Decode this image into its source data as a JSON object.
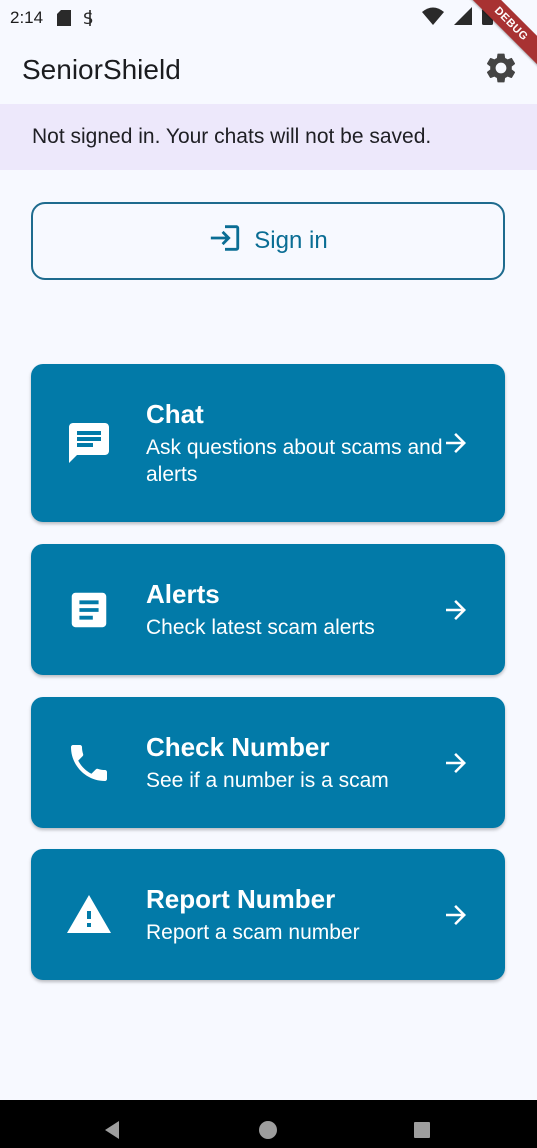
{
  "status_bar": {
    "time": "2:14",
    "debug_label": "DEBUG"
  },
  "app_bar": {
    "title": "SeniorShield",
    "settings_icon": "gear-icon"
  },
  "banner": {
    "text": "Not signed in. Your chats will not be saved."
  },
  "sign_in": {
    "label": "Sign in",
    "icon": "login-icon"
  },
  "cards": [
    {
      "title": "Chat",
      "subtitle": "Ask questions about scams and alerts",
      "icon": "chat-icon"
    },
    {
      "title": "Alerts",
      "subtitle": "Check latest scam alerts",
      "icon": "article-icon"
    },
    {
      "title": "Check Number",
      "subtitle": "See if a number is a scam",
      "icon": "phone-icon"
    },
    {
      "title": "Report Number",
      "subtitle": "Report a scam number",
      "icon": "warning-icon"
    }
  ],
  "colors": {
    "primary": "#027aa8",
    "outline": "#1e6b8e",
    "banner_bg": "#ede8fb",
    "background": "#f7f9ff"
  }
}
